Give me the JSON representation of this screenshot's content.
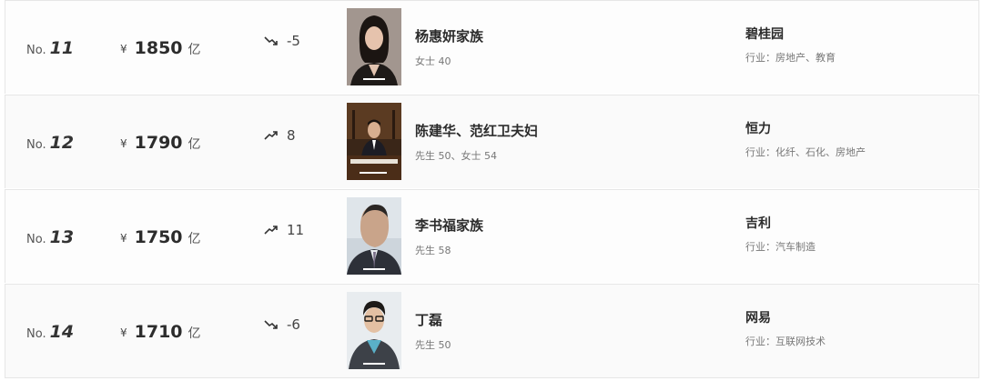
{
  "rows": [
    {
      "rank_prefix": "No.",
      "rank": "11",
      "currency": "¥",
      "amount": "1850",
      "unit": "亿",
      "trend": "down",
      "change": "-5",
      "name": "杨惠妍家族",
      "info": "女士  40",
      "company": "碧桂园",
      "industry": "行业：房地产、教育"
    },
    {
      "rank_prefix": "No.",
      "rank": "12",
      "currency": "¥",
      "amount": "1790",
      "unit": "亿",
      "trend": "up",
      "change": "8",
      "name": "陈建华、范红卫夫妇",
      "info": "先生  50、女士  54",
      "company": "恒力",
      "industry": "行业：化纤、石化、房地产"
    },
    {
      "rank_prefix": "No.",
      "rank": "13",
      "currency": "¥",
      "amount": "1750",
      "unit": "亿",
      "trend": "up",
      "change": "11",
      "name": "李书福家族",
      "info": "先生  58",
      "company": "吉利",
      "industry": "行业：汽车制造"
    },
    {
      "rank_prefix": "No.",
      "rank": "14",
      "currency": "¥",
      "amount": "1710",
      "unit": "亿",
      "trend": "down",
      "change": "-6",
      "name": "丁磊",
      "info": "先生  50",
      "company": "网易",
      "industry": "行业：互联网技术"
    }
  ]
}
